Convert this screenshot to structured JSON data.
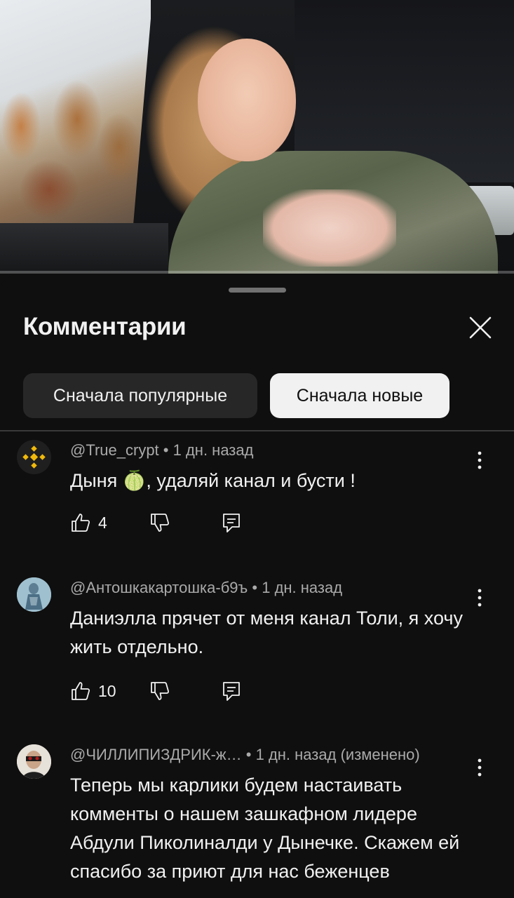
{
  "video": {
    "progress_fraction": 0.0
  },
  "sheet": {
    "title": "Комментарии",
    "sort_chips": [
      {
        "label": "Сначала популярные",
        "selected": false
      },
      {
        "label": "Сначала новые",
        "selected": true
      }
    ]
  },
  "comments": [
    {
      "author": "@True_crypt",
      "time": "1 дн. назад",
      "edited": "",
      "text": "Дыня 🍈, удаляй канал и бусти !",
      "likes": "4",
      "avatar_icon": "binance-logo-icon"
    },
    {
      "author": "@Антошкакартошка-б9ъ",
      "time": "1 дн. назад",
      "edited": "",
      "text": "Даниэлла прячет от меня канал Толи, я хочу жить отдельно.",
      "likes": "10",
      "avatar_icon": "figure-avatar-icon"
    },
    {
      "author": "@ЧИЛЛИПИЗДРИК-ж…",
      "time": "1 дн. назад",
      "edited": "(изменено)",
      "text": "Теперь мы карлики будем настаивать комменты о нашем зашкафном лидере Абдули Пиколиналди у Дынечке. Скажем ей спасибо за приют для нас беженцев",
      "likes": "",
      "avatar_icon": "portrait-avatar-icon"
    }
  ],
  "colors": {
    "background": "#0f0f0f",
    "chip_dark": "#272727",
    "chip_selected": "#f1f1f1",
    "meta_text": "#aaaaaa"
  }
}
